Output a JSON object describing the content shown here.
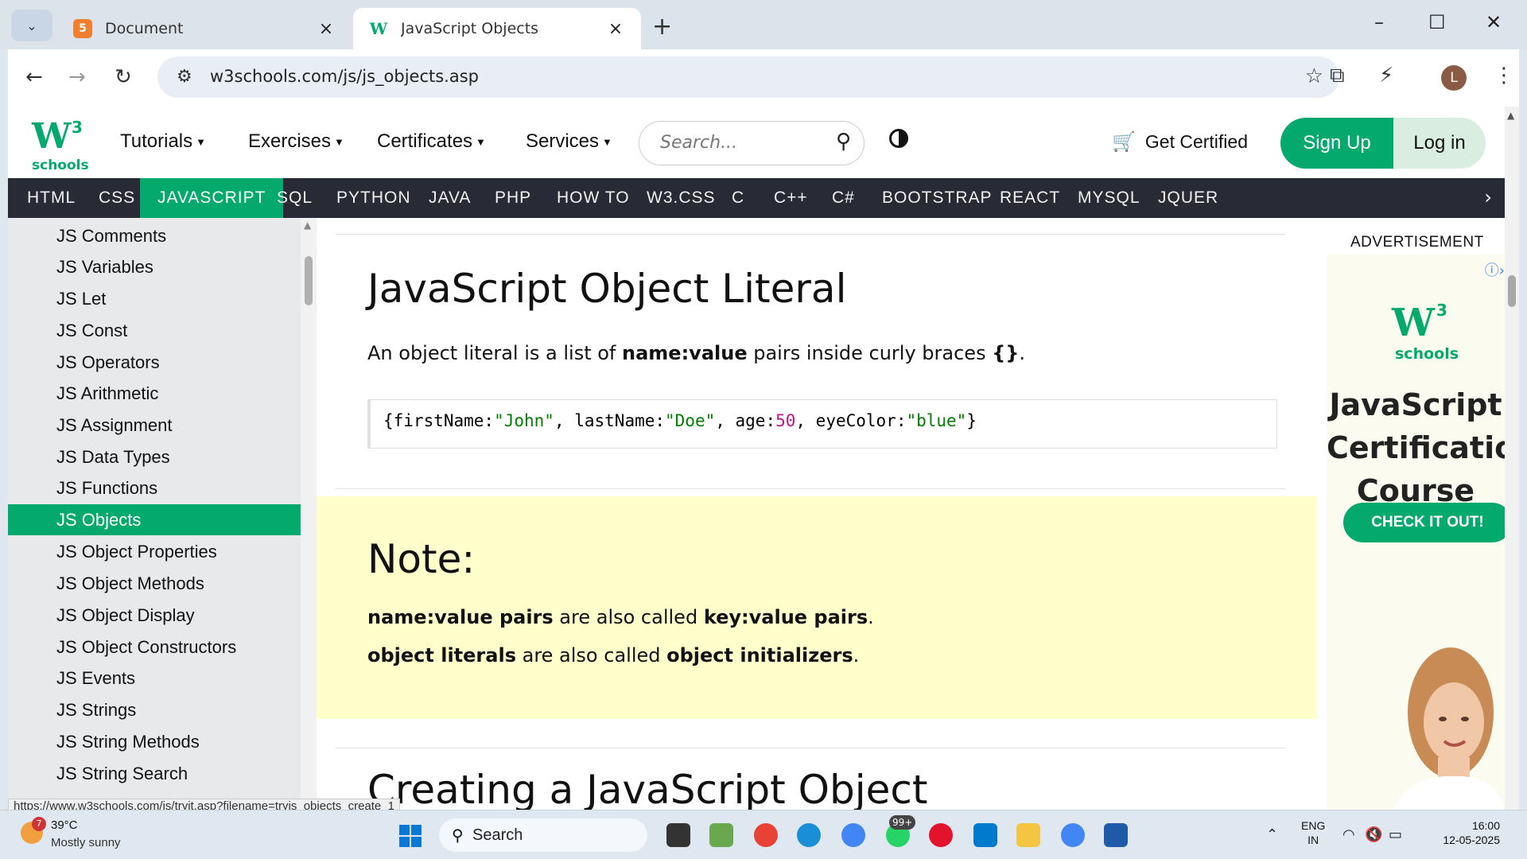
{
  "browser": {
    "tabs": [
      {
        "title": "Document",
        "icon": "html5-icon"
      },
      {
        "title": "JavaScript Objects",
        "icon": "w3schools-icon",
        "active": true
      }
    ],
    "url": "w3schools.com/js/js_objects.asp",
    "status_url": "https://www.w3schools.com/js/tryit.asp?filename=tryjs_objects_create_1",
    "profile_initial": "L"
  },
  "header": {
    "logo_main": "W",
    "logo_sup": "3",
    "logo_sub": "schools",
    "menu": [
      "Tutorials",
      "Exercises",
      "Certificates",
      "Services"
    ],
    "search_placeholder": "Search...",
    "get_certified": "Get Certified",
    "sign_up": "Sign Up",
    "log_in": "Log in"
  },
  "nav": {
    "items": [
      "HTML",
      "CSS",
      "JAVASCRIPT",
      "SQL",
      "PYTHON",
      "JAVA",
      "PHP",
      "HOW TO",
      "W3.CSS",
      "C",
      "C++",
      "C#",
      "BOOTSTRAP",
      "REACT",
      "MYSQL",
      "JQUER"
    ],
    "active": "JAVASCRIPT"
  },
  "sidebar": {
    "items": [
      "JS Comments",
      "JS Variables",
      "JS Let",
      "JS Const",
      "JS Operators",
      "JS Arithmetic",
      "JS Assignment",
      "JS Data Types",
      "JS Functions",
      "JS Objects",
      "JS Object Properties",
      "JS Object Methods",
      "JS Object Display",
      "JS Object Constructors",
      "JS Events",
      "JS Strings",
      "JS String Methods",
      "JS String Search"
    ],
    "active": "JS Objects"
  },
  "content": {
    "heading": "JavaScript Object Literal",
    "intro_pre": "An object literal is a list of ",
    "intro_bold": "name:value",
    "intro_mid": " pairs inside curly braces ",
    "intro_braces": "{}",
    "intro_end": ".",
    "code": {
      "open": "{firstName:",
      "v1": "\"John\"",
      "k2": ", lastName:",
      "v2": "\"Doe\"",
      "k3": ", age:",
      "v3": "50",
      "k4": ", eyeColor:",
      "v4": "\"blue\"",
      "close": "}"
    },
    "note_heading": "Note:",
    "note1_b1": "name:value pairs",
    "note1_mid": " are also called ",
    "note1_b2": "key:value pairs",
    "note1_end": ".",
    "note2_b1": "object literals",
    "note2_mid": " are also called ",
    "note2_b2": "object initializers",
    "note2_end": ".",
    "next_heading": "Creating a JavaScript Object"
  },
  "ad": {
    "label": "ADVERTISEMENT",
    "logo_main": "W",
    "logo_sup": "3",
    "logo_sub": "schools",
    "title": "JavaScript Certification Course",
    "button": "CHECK IT OUT!"
  },
  "taskbar": {
    "weather_temp": "39°C",
    "weather_desc": "Mostly sunny",
    "weather_badge": "7",
    "search_label": "Search",
    "whatsapp_badge": "99+",
    "lang_1": "ENG",
    "lang_2": "IN",
    "time": "16:00",
    "date": "12-05-2025"
  },
  "colors": {
    "w3_green": "#04aa6d",
    "nav_dark": "#282a35",
    "note_bg": "#ffffcc",
    "sidebar_bg": "#e7e9eb"
  }
}
